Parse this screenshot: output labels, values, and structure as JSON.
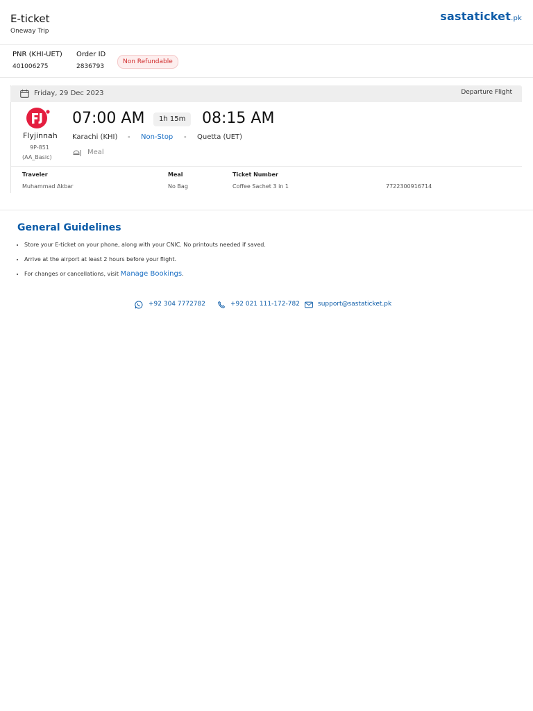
{
  "header": {
    "title": "E-ticket",
    "subtitle": "Oneway Trip",
    "brand": "sastaticket",
    "brand_suffix": ".pk"
  },
  "booking": {
    "pnr_label": "PNR (KHI-UET)",
    "pnr_value": "401006275",
    "order_label": "Order ID",
    "order_value": "2836793",
    "refund_badge": "Non Refundable"
  },
  "flight": {
    "date": "Friday, 29 Dec 2023",
    "direction": "Departure Flight",
    "airline": "Flyjinnah",
    "flight_number": "9P-851",
    "fare_class": "(AA_Basic)",
    "depart_time": "07:00 AM",
    "duration": "1h 15m",
    "arrive_time": "08:15 AM",
    "origin": "Karachi (KHI)",
    "stops": "Non-Stop",
    "destination": "Quetta (UET)",
    "separator": "-",
    "meal": "Meal"
  },
  "passenger_table": {
    "headers": [
      "Traveler",
      "Meal",
      "Ticket Number"
    ],
    "rows": [
      [
        "Muhammad Akbar",
        "No Bag",
        "Coffee Sachet 3 in 1",
        "7722300916714"
      ]
    ]
  },
  "guidelines": {
    "title": "General Guidelines",
    "items": [
      "Store your E-ticket on your phone, along with your CNIC. No printouts needed if saved.",
      "Arrive at the airport at least 2 hours before your flight.",
      "For changes or cancellations, visit "
    ],
    "link_text": "Manage Bookings",
    "link_suffix": "."
  },
  "contacts": {
    "whatsapp": "+92 304 7772782",
    "phone": "+92 021 111-172-782",
    "email": "support@sastaticket.pk"
  },
  "colors": {
    "brand": "#0d5ca8",
    "link": "#1a6fc4",
    "badge_text": "#d02b2b",
    "airline_red": "#e41e3f"
  }
}
